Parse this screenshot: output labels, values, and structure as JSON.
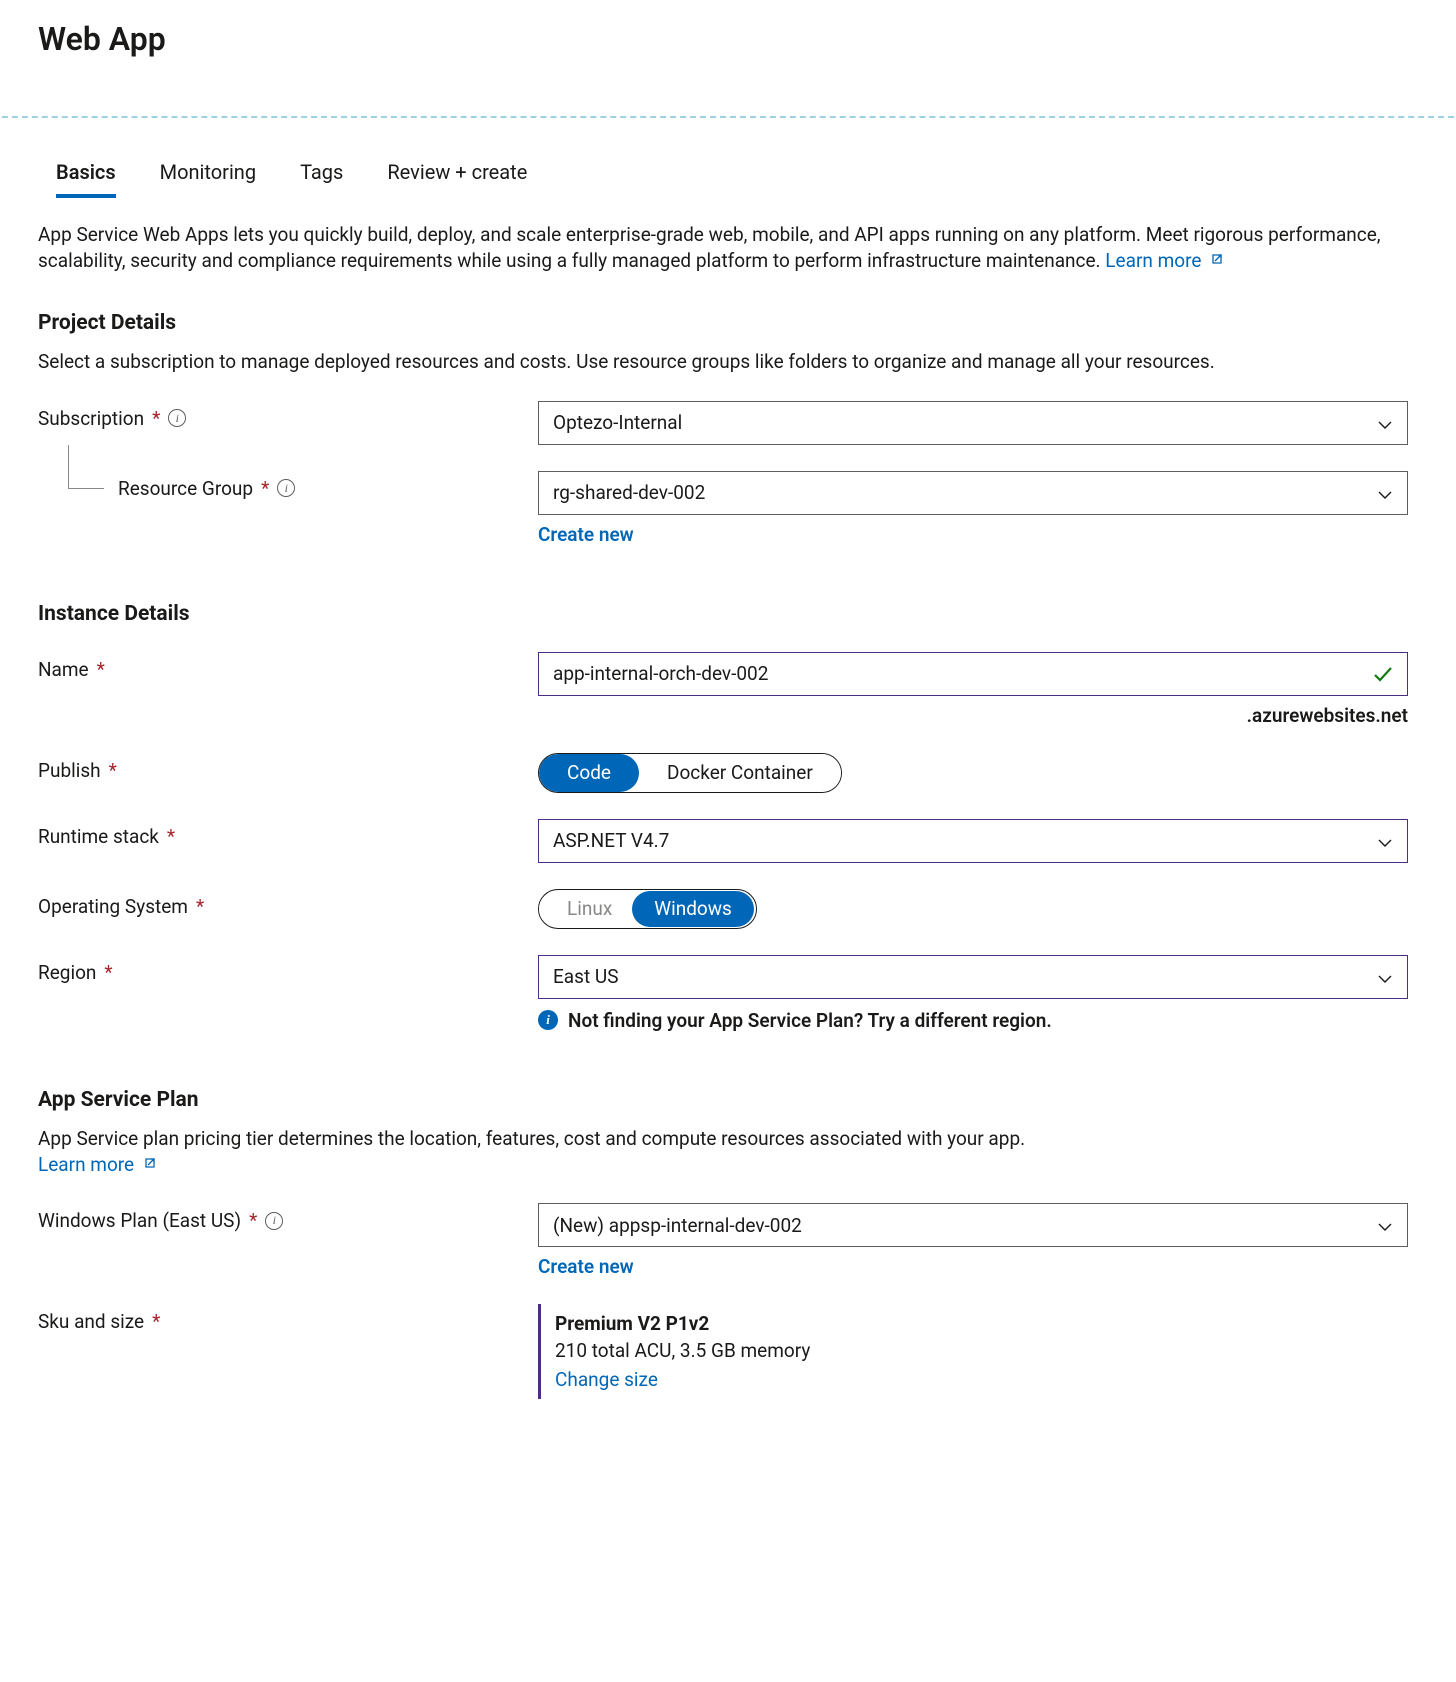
{
  "header": {
    "title": "Web App"
  },
  "tabs": [
    {
      "label": "Basics",
      "active": true
    },
    {
      "label": "Monitoring",
      "active": false
    },
    {
      "label": "Tags",
      "active": false
    },
    {
      "label": "Review + create",
      "active": false
    }
  ],
  "intro": {
    "text": "App Service Web Apps lets you quickly build, deploy, and scale enterprise-grade web, mobile, and API apps running on any platform. Meet rigorous performance, scalability, security and compliance requirements while using a fully managed platform to perform infrastructure maintenance.  ",
    "learn_more": "Learn more"
  },
  "project_details": {
    "heading": "Project Details",
    "desc": "Select a subscription to manage deployed resources and costs. Use resource groups like folders to organize and manage all your resources.",
    "subscription_label": "Subscription",
    "subscription_value": "Optezo-Internal",
    "resource_group_label": "Resource Group",
    "resource_group_value": "rg-shared-dev-002",
    "create_new": "Create new"
  },
  "instance_details": {
    "heading": "Instance Details",
    "name_label": "Name",
    "name_value": "app-internal-orch-dev-002",
    "domain_suffix": ".azurewebsites.net",
    "publish_label": "Publish",
    "publish_options": [
      {
        "label": "Code",
        "selected": true
      },
      {
        "label": "Docker Container",
        "selected": false
      }
    ],
    "runtime_label": "Runtime stack",
    "runtime_value": "ASP.NET V4.7",
    "os_label": "Operating System",
    "os_options": [
      {
        "label": "Linux",
        "selected": false,
        "disabled": true
      },
      {
        "label": "Windows",
        "selected": true,
        "disabled": false
      }
    ],
    "region_label": "Region",
    "region_value": "East US",
    "region_hint": "Not finding your App Service Plan? Try a different region."
  },
  "app_service_plan": {
    "heading": "App Service Plan",
    "desc": "App Service plan pricing tier determines the location, features, cost and compute resources associated with your app.",
    "learn_more": "Learn more",
    "plan_label": "Windows Plan (East US)",
    "plan_value": "(New) appsp-internal-dev-002",
    "create_new": "Create new",
    "sku_label": "Sku and size",
    "sku_title": "Premium V2 P1v2",
    "sku_detail": "210 total ACU, 3.5 GB memory",
    "change_size": "Change size"
  }
}
